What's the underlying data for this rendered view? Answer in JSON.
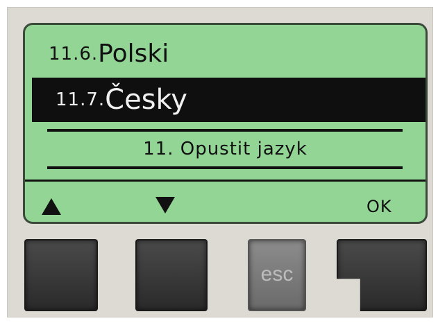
{
  "menu": {
    "items": [
      {
        "number": "11.6.",
        "label": "Polski"
      },
      {
        "number": "11.7.",
        "label": "Česky"
      }
    ],
    "exit_label": "11. Opustit jazyk"
  },
  "softkeys": {
    "up_icon": "triangle-up-icon",
    "down_icon": "triangle-down-icon",
    "ok_label": "OK"
  },
  "buttons": {
    "esc_label": "esc"
  },
  "colors": {
    "lcd_background": "#92d595",
    "selection_background": "#0f0f0f"
  }
}
